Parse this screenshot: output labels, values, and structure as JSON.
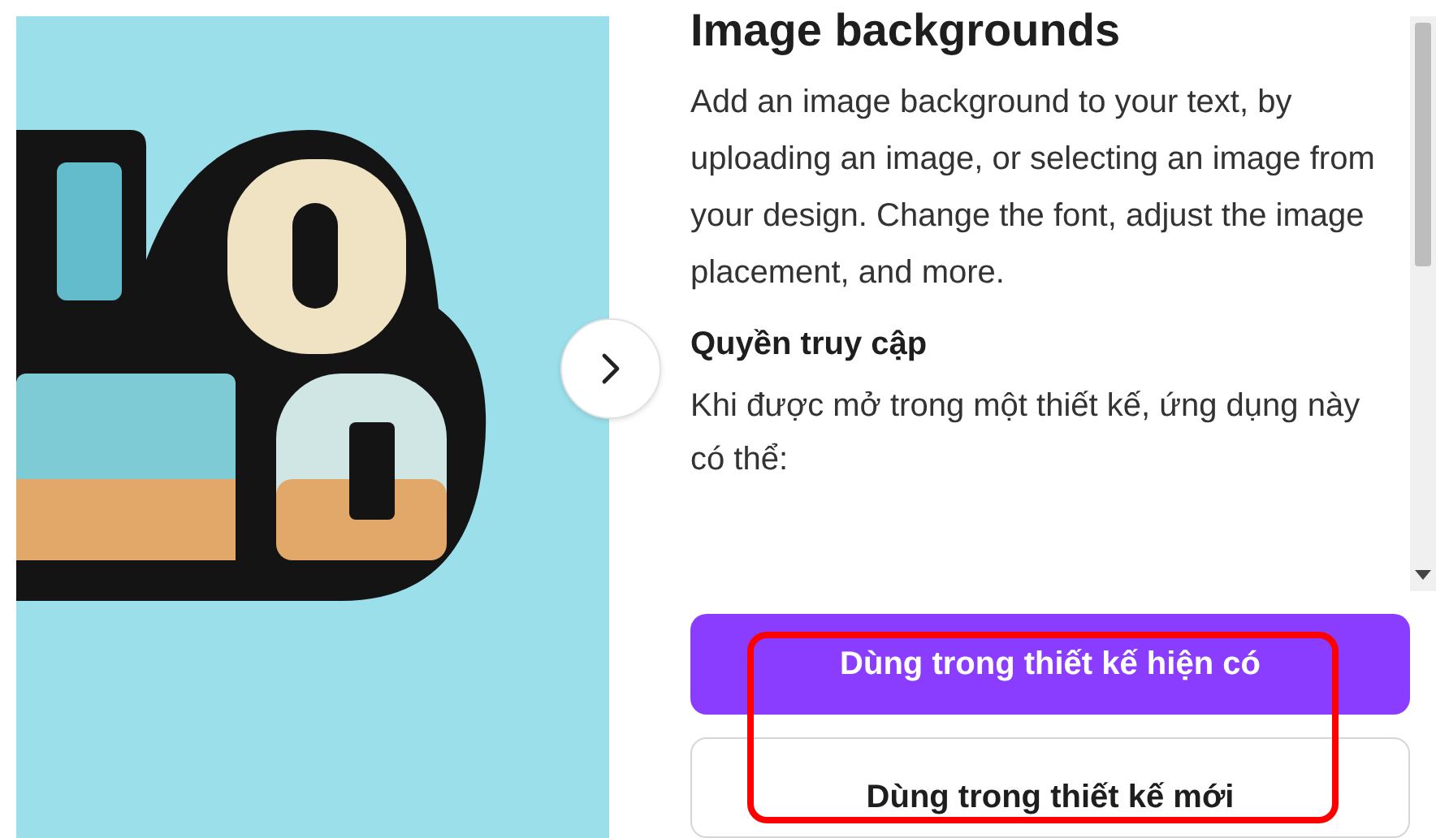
{
  "panel": {
    "title": "Image backgrounds",
    "description": "Add an image background to your text, by uploading an image, or selecting an image from your design. Change the font, adjust the image placement, and more.",
    "permissions_heading": "Quyền truy cập",
    "permissions_text": "Khi được mở trong một thiết kế, ứng dụng này có thể:"
  },
  "buttons": [
    {
      "label": "Dùng trong thiết kế hiện có",
      "kind": "primary"
    },
    {
      "label": "Dùng trong thiết kế mới",
      "kind": "secondary"
    }
  ],
  "annotation": {
    "highlighted": true
  }
}
